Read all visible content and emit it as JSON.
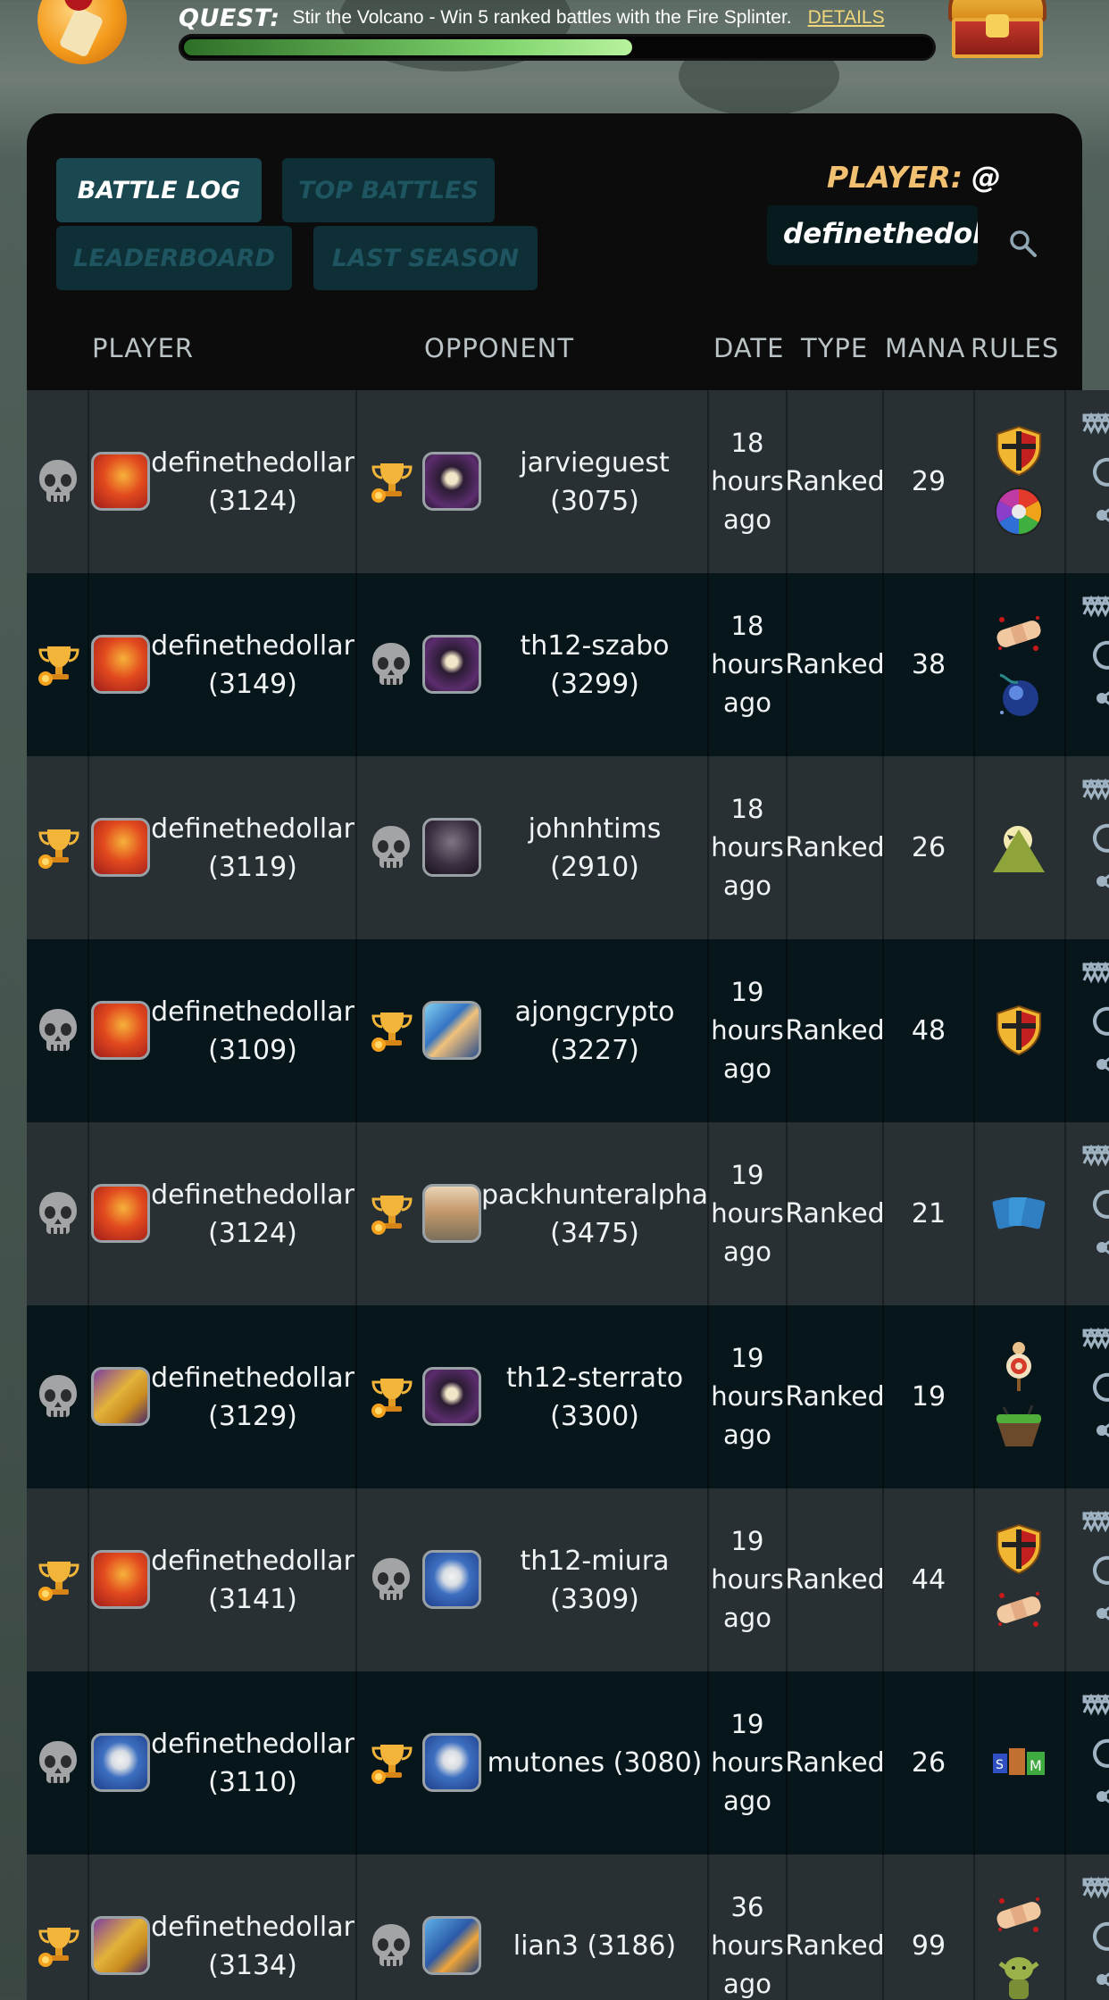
{
  "quest": {
    "label": "QUEST:",
    "description": "Stir the Volcano - Win 5 ranked battles with the Fire Splinter.",
    "details_link": "DETAILS",
    "progress": 0.6
  },
  "tabs": {
    "battle_log": "BATTLE LOG",
    "top_battles": "TOP BATTLES",
    "leaderboard": "LEADERBOARD",
    "last_season": "LAST SEASON"
  },
  "player_search": {
    "label": "PLAYER:",
    "at": "@",
    "value": "definethedollar",
    "icon": "search-icon"
  },
  "columns": {
    "player": "PLAYER",
    "opponent": "OPPONENT",
    "date": "DATE",
    "type": "TYPE",
    "mana": "MANA",
    "rules": "RULES"
  },
  "colors": {
    "accent": "#f2c071",
    "tab_active": "#1a4851",
    "tab_inactive": "#0d2f35",
    "row_light": "#293033",
    "row_dark": "#07161b",
    "quest_progress": "#7ed36c"
  },
  "battles": [
    {
      "player_result": "loss",
      "player_avatar": "fire-dragon",
      "player": "definethedollar",
      "player_rating": "(3124)",
      "opponent_result": "win",
      "opponent_avatar": "death-hooded",
      "opponent": "jarvieguest",
      "opponent_rating": "(3075)",
      "date": "18 hours ago",
      "type": "Ranked",
      "mana": "29",
      "rules": [
        "armored-shield",
        "rainbow-wheel"
      ]
    },
    {
      "player_result": "win",
      "player_avatar": "fire-dragon",
      "player": "definethedollar",
      "player_rating": "(3149)",
      "opponent_result": "loss",
      "opponent_avatar": "death-hooded",
      "opponent": "th12-szabo",
      "opponent_rating": "(3299)",
      "date": "18 hours ago",
      "type": "Ranked",
      "mana": "38",
      "rules": [
        "bandage",
        "dark-orb"
      ]
    },
    {
      "player_result": "win",
      "player_avatar": "fire-dragon",
      "player": "definethedollar",
      "player_rating": "(3119)",
      "opponent_result": "loss",
      "opponent_avatar": "death-ghost",
      "opponent": "johnhtims (2910)",
      "opponent_rating": "",
      "date": "18 hours ago",
      "type": "Ranked",
      "mana": "26",
      "rules": [
        "moonlit-mountain"
      ]
    },
    {
      "player_result": "loss",
      "player_avatar": "fire-dragon",
      "player": "definethedollar",
      "player_rating": "(3109)",
      "opponent_result": "win",
      "opponent_avatar": "water-mage",
      "opponent": "ajongcrypto",
      "opponent_rating": "(3227)",
      "date": "19 hours ago",
      "type": "Ranked",
      "mana": "48",
      "rules": [
        "armored-shield"
      ]
    },
    {
      "player_result": "loss",
      "player_avatar": "fire-dragon",
      "player": "definethedollar",
      "player_rating": "(3124)",
      "opponent_result": "win",
      "opponent_avatar": "life-hero",
      "opponent": "packhunteralpha",
      "opponent_rating": "(3475)",
      "date": "19 hours ago",
      "type": "Ranked",
      "mana": "21",
      "rules": [
        "cards"
      ]
    },
    {
      "player_result": "loss",
      "player_avatar": "dragon-knight",
      "player": "definethedollar",
      "player_rating": "(3129)",
      "opponent_result": "win",
      "opponent_avatar": "death-hooded",
      "opponent": "th12-sterrato",
      "opponent_rating": "(3300)",
      "date": "19 hours ago",
      "type": "Ranked",
      "mana": "19",
      "rules": [
        "target-dummy",
        "floating-island"
      ]
    },
    {
      "player_result": "win",
      "player_avatar": "fire-dragon",
      "player": "definethedollar",
      "player_rating": "(3141)",
      "opponent_result": "loss",
      "opponent_avatar": "water-wizard",
      "opponent": "th12-miura",
      "opponent_rating": "(3309)",
      "date": "19 hours ago",
      "type": "Ranked",
      "mana": "44",
      "rules": [
        "armored-shield",
        "bandage"
      ]
    },
    {
      "player_result": "loss",
      "player_avatar": "water-wizard",
      "player": "definethedollar",
      "player_rating": "(3110)",
      "opponent_result": "win",
      "opponent_avatar": "water-wizard",
      "opponent": "mutones (3080)",
      "opponent_rating": "",
      "date": "19 hours ago",
      "type": "Ranked",
      "mana": "26",
      "rules": [
        "small-medium-large"
      ]
    },
    {
      "player_result": "win",
      "player_avatar": "dragon-knight",
      "player": "definethedollar",
      "player_rating": "(3134)",
      "opponent_result": "loss",
      "opponent_avatar": "water-rider",
      "opponent": "lian3 (3186)",
      "opponent_rating": "",
      "date": "36 hours ago",
      "type": "Ranked",
      "mana": "99",
      "rules": [
        "bandage",
        "goblin"
      ]
    }
  ]
}
